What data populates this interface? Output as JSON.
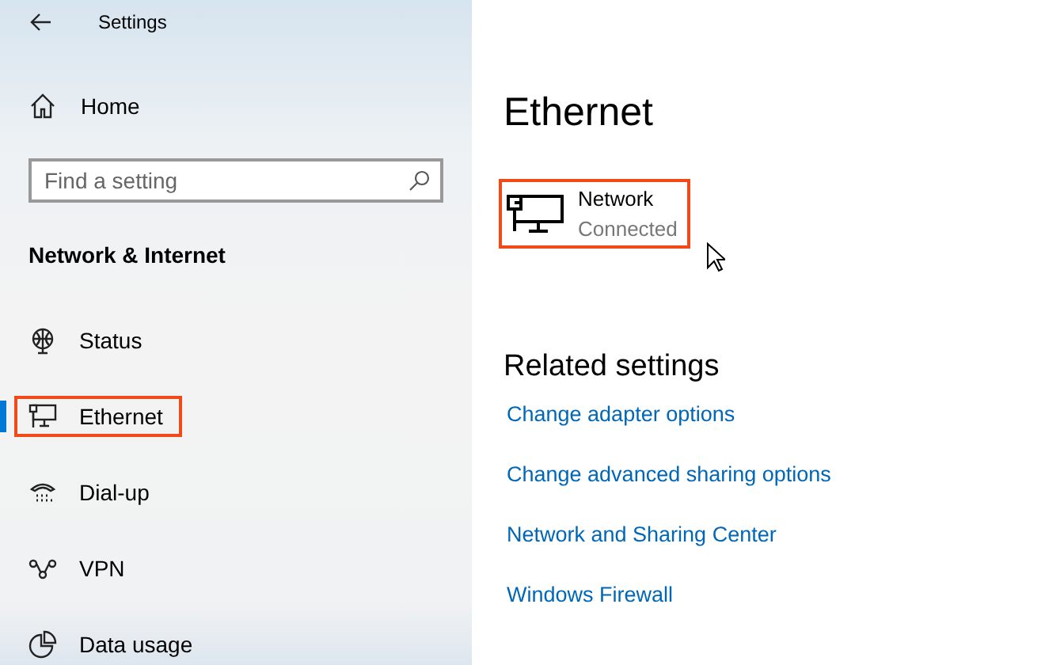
{
  "window": {
    "title": "Settings"
  },
  "sidebar": {
    "home": "Home",
    "search": {
      "placeholder": "Find a setting"
    },
    "section": "Network & Internet",
    "items": [
      {
        "label": "Status",
        "kind": "globe",
        "selected": false,
        "highlighted": false
      },
      {
        "label": "Ethernet",
        "kind": "ethernet",
        "selected": true,
        "highlighted": true
      },
      {
        "label": "Dial-up",
        "kind": "phone",
        "selected": false,
        "highlighted": false
      },
      {
        "label": "VPN",
        "kind": "vpn",
        "selected": false,
        "highlighted": false
      },
      {
        "label": "Data usage",
        "kind": "pie",
        "selected": false,
        "highlighted": false
      }
    ]
  },
  "main": {
    "title": "Ethernet",
    "network": {
      "name": "Network",
      "status": "Connected",
      "highlighted": true
    },
    "related_title": "Related settings",
    "links": [
      "Change adapter options",
      "Change advanced sharing options",
      "Network and Sharing Center",
      "Windows Firewall"
    ]
  }
}
